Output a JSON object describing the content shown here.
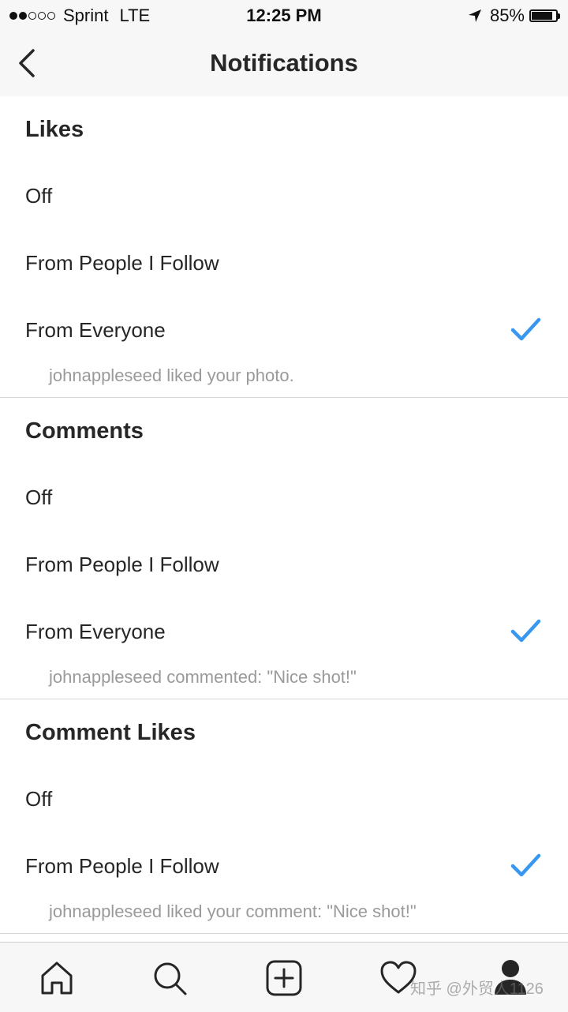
{
  "status_bar": {
    "carrier": "Sprint",
    "network": "LTE",
    "time": "12:25 PM",
    "battery_percent": "85%",
    "battery_level": 0.85,
    "signal_bars_filled": 2,
    "signal_bars_total": 5
  },
  "nav": {
    "title": "Notifications",
    "back_icon": "chevron-left-icon"
  },
  "sections": [
    {
      "title": "Likes",
      "options": [
        {
          "label": "Off",
          "selected": false
        },
        {
          "label": "From People I Follow",
          "selected": false
        },
        {
          "label": "From Everyone",
          "selected": true
        }
      ],
      "hint": "johnappleseed liked your photo."
    },
    {
      "title": "Comments",
      "options": [
        {
          "label": "Off",
          "selected": false
        },
        {
          "label": "From People I Follow",
          "selected": false
        },
        {
          "label": "From Everyone",
          "selected": true
        }
      ],
      "hint": "johnappleseed commented: \"Nice shot!\""
    },
    {
      "title": "Comment Likes",
      "options": [
        {
          "label": "Off",
          "selected": false
        },
        {
          "label": "From People I Follow",
          "selected": true
        }
      ],
      "hint": "johnappleseed liked your comment: \"Nice shot!\""
    }
  ],
  "tab_bar": {
    "tabs": [
      {
        "icon": "home-icon"
      },
      {
        "icon": "search-icon"
      },
      {
        "icon": "add-post-icon"
      },
      {
        "icon": "heart-icon"
      },
      {
        "icon": "profile-icon"
      }
    ]
  },
  "watermark": "知乎 @外贸人1126",
  "colors": {
    "accent": "#3897f0",
    "text": "#262626",
    "hint": "#9a9a9a",
    "bar_bg": "#f7f7f7",
    "divider": "#d6d6d6"
  }
}
